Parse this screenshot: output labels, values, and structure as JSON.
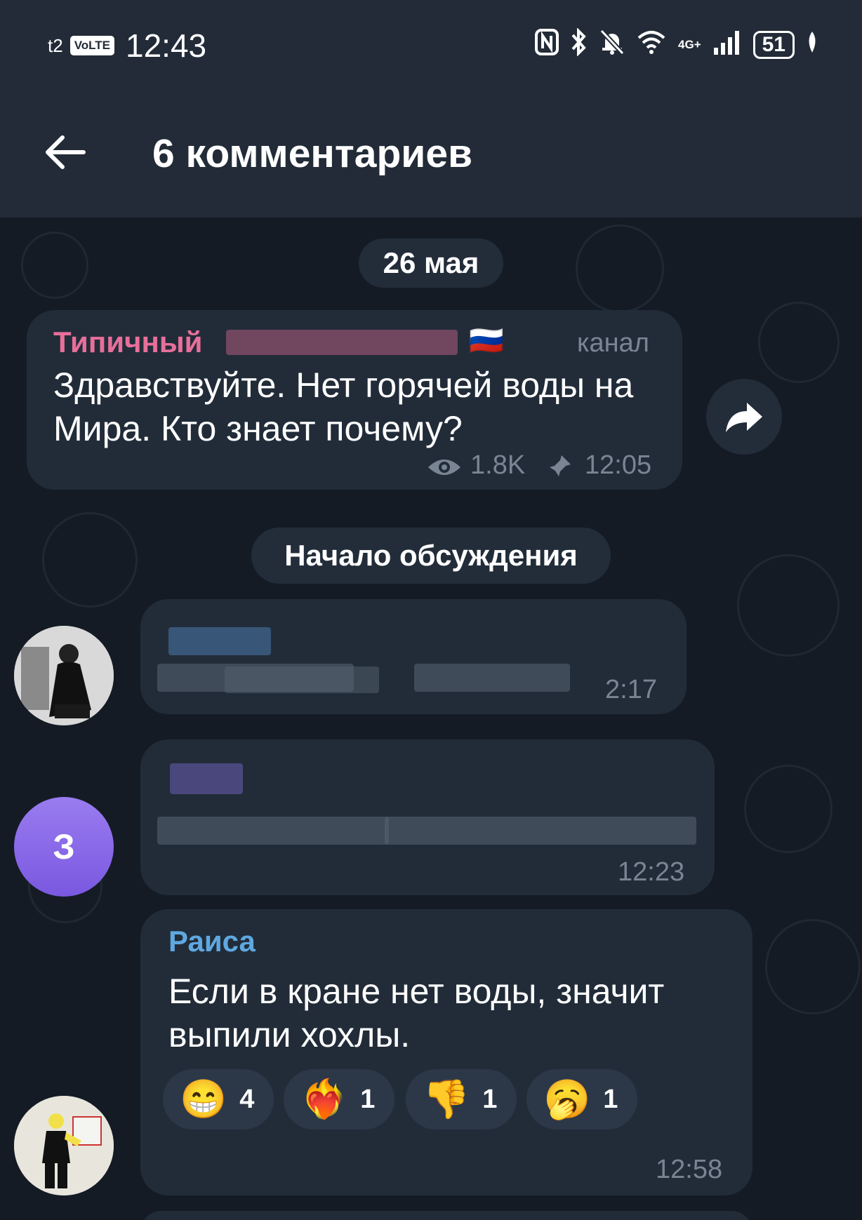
{
  "status_bar": {
    "carrier": "t2",
    "volte": "VoLTE",
    "time": "12:43",
    "network": "4G+",
    "battery": "51"
  },
  "header": {
    "title": "6 комментариев"
  },
  "chat": {
    "date_label": "26 мая",
    "channel_post": {
      "sender": "Типичный",
      "flag": "🇷🇺",
      "badge": "канал",
      "text": "Здравствуйте. Нет горячей воды на Мира. Кто знает почему?",
      "views": "1.8K",
      "time": "12:05"
    },
    "discussion_label": "Начало обсуждения",
    "comments": [
      {
        "time": "2:17",
        "blurred": true
      },
      {
        "avatar_letter": "З",
        "time": "12:23",
        "blurred": true
      },
      {
        "sender": "Раиса",
        "text": "Если в кране нет воды, значит выпили хохлы.",
        "time": "12:58",
        "reactions": [
          {
            "emoji": "😁",
            "count": "4"
          },
          {
            "emoji": "❤️‍🔥",
            "count": "1"
          },
          {
            "emoji": "👎",
            "count": "1"
          },
          {
            "emoji": "🥱",
            "count": "1"
          }
        ]
      }
    ]
  },
  "colors": {
    "background": "#141b25",
    "header": "#222b37",
    "bubble": "#222c39",
    "channel_sender": "#e86f9a",
    "user_sender": "#5fa8e0",
    "meta": "#7a8594",
    "avatar_gradient": [
      "#9a7cf0",
      "#7a58e0"
    ]
  }
}
